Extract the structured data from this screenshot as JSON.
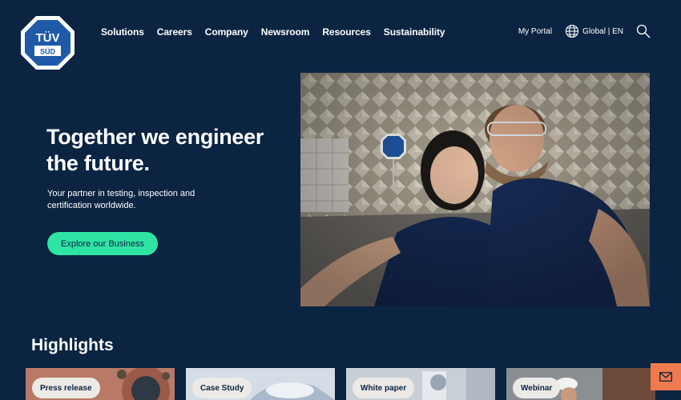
{
  "logo": {
    "text_top": "TÜV",
    "text_bottom": "SÜD"
  },
  "nav": {
    "items": [
      "Solutions",
      "Careers",
      "Company",
      "Newsroom",
      "Resources",
      "Sustainability"
    ]
  },
  "header_right": {
    "portal": "My Portal",
    "language": "Global | EN",
    "globe_icon": "globe-icon",
    "search_icon": "search-icon"
  },
  "hero": {
    "title": "Together we engineer the future.",
    "subtitle": "Your partner in testing, inspection and certification worldwide.",
    "cta": "Explore our Business"
  },
  "highlights": {
    "title": "Highlights",
    "cards": [
      {
        "badge": "Press release"
      },
      {
        "badge": "Case Study"
      },
      {
        "badge": "White paper"
      },
      {
        "badge": "Webinar"
      }
    ]
  },
  "colors": {
    "background": "#0b2442",
    "accent": "#2fe3a3",
    "brand_blue": "#1f5aa8",
    "mail_button": "#f07a4f"
  }
}
